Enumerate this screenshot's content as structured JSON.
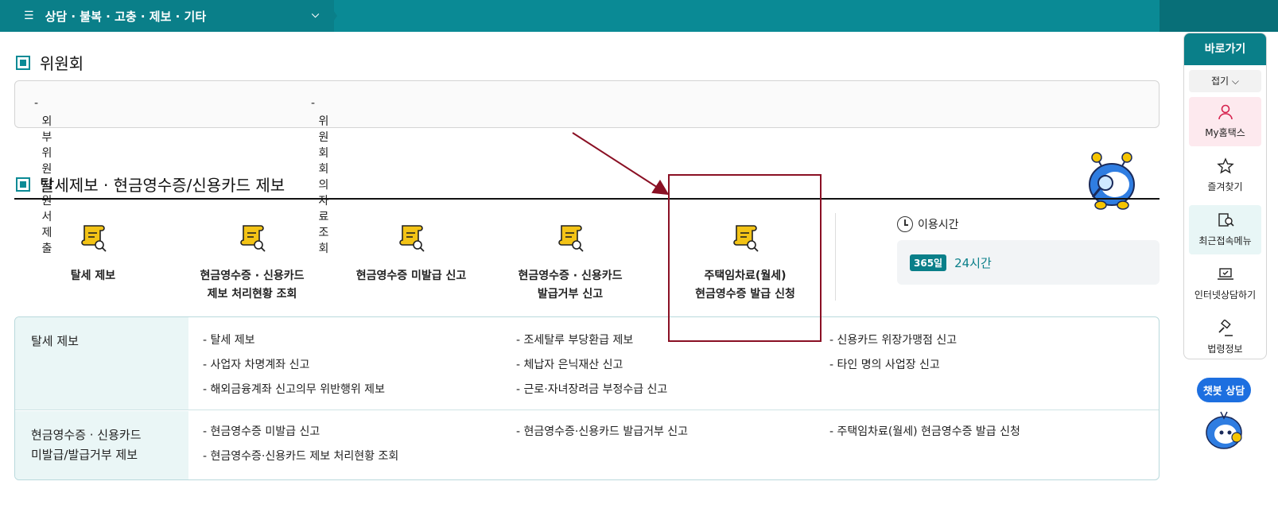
{
  "topnav": {
    "menu_label": "상담 · 불복 · 고충 · 제보 · 기타"
  },
  "committee": {
    "title": "위원회",
    "links": [
      "외부위원 지원서 제출",
      "위원회 회의 자료 조회"
    ]
  },
  "report_section": {
    "title": "탈세제보 · 현금영수증/신용카드 제보",
    "tiles": [
      {
        "line1": "탈세 제보",
        "line2": "",
        "icon": "document-search-icon"
      },
      {
        "line1": "현금영수증 · 신용카드",
        "line2": "제보 처리현황 조회",
        "icon": "document-search-icon"
      },
      {
        "line1": "현금영수증 미발급 신고",
        "line2": "",
        "icon": "document-search-icon"
      },
      {
        "line1": "현금영수증 · 신용카드",
        "line2": "발급거부 신고",
        "icon": "document-search-icon"
      },
      {
        "line1": "주택임차료(월세)",
        "line2": "현금영수증 발급 신청",
        "icon": "document-search-icon"
      }
    ],
    "usage": {
      "title": "이용시간",
      "badge": "365일",
      "hours": "24시간"
    }
  },
  "table": {
    "rows": [
      {
        "head": "탈세 제보",
        "items": [
          "탈세 제보",
          "조세탈루 부당환급 제보",
          "신용카드 위장가맹점 신고",
          "사업자 차명계좌 신고",
          "체납자 은닉재산 신고",
          "타인 명의 사업장 신고",
          "해외금융계좌 신고의무 위반행위 제보",
          "근로·자녀장려금 부정수급 신고"
        ]
      },
      {
        "head_line1": "현금영수증 · 신용카드",
        "head_line2": "미발급/발급거부 제보",
        "items": [
          "현금영수증 미발급 신고",
          "현금영수증·신용카드 발급거부 신고",
          "주택임차료(월세) 현금영수증 발급 신청",
          "현금영수증·신용카드 제보 처리현황 조회"
        ]
      }
    ]
  },
  "quick_menu": {
    "title": "바로가기",
    "fold": "접기",
    "items": [
      "My홈택스",
      "즐겨찾기",
      "최근접속메뉴",
      "인터넷상담하기",
      "법령정보"
    ]
  },
  "chatbot": {
    "label": "챗봇 상담"
  },
  "colors": {
    "teal": "#0a8a95",
    "highlight": "#8a1024"
  }
}
